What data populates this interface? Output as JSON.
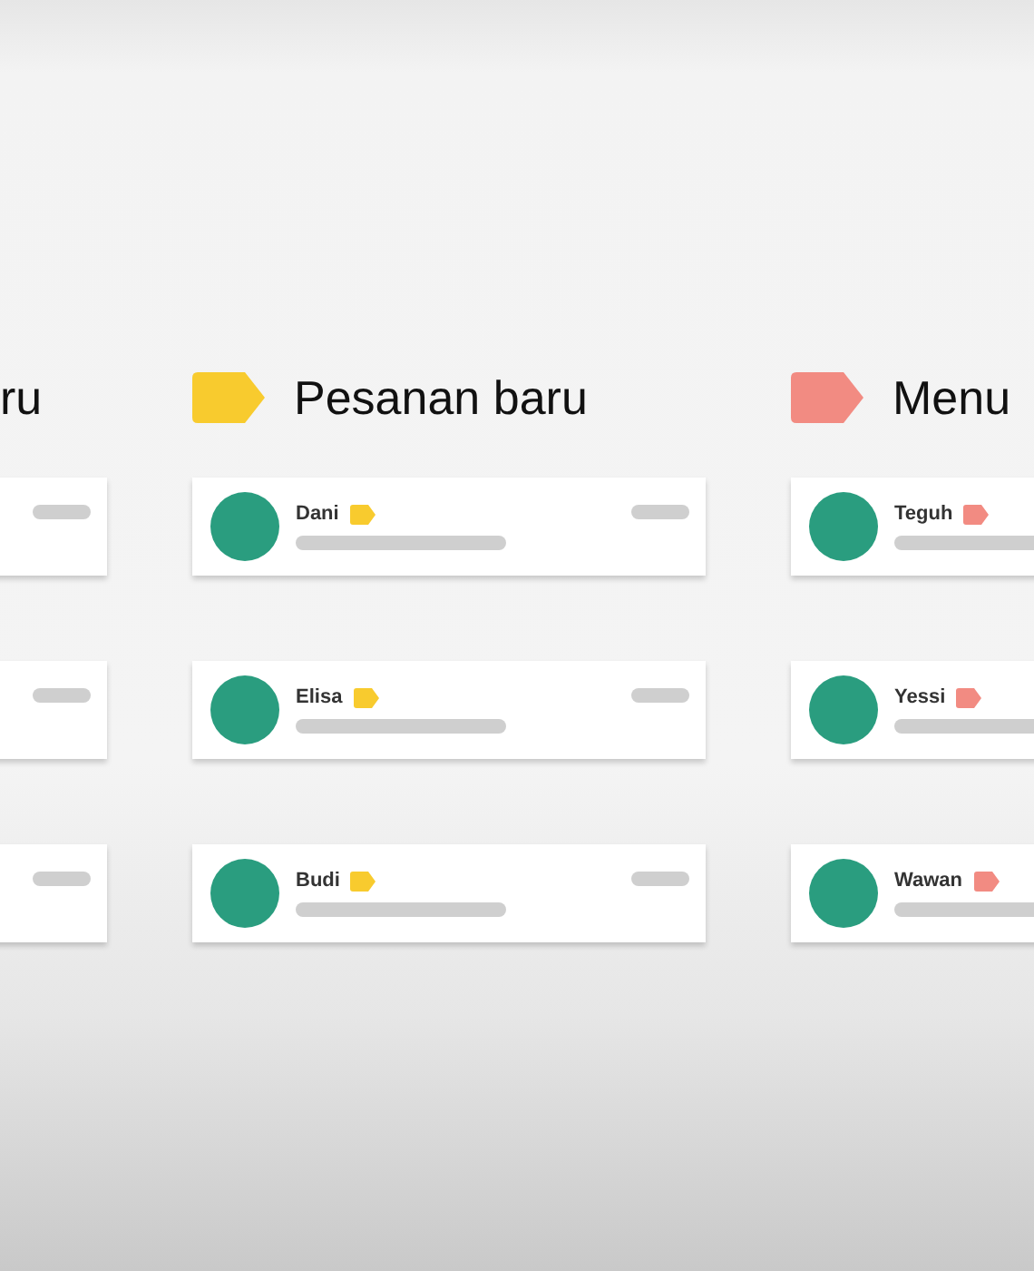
{
  "columns": [
    {
      "heading": "ru",
      "cards": [
        {
          "kind": "cut-left"
        },
        {
          "kind": "cut-left"
        },
        {
          "kind": "cut-left"
        }
      ]
    },
    {
      "heading": "Pesanan baru",
      "color": "#f8cb2e",
      "cards": [
        {
          "kind": "full",
          "name": "Dani"
        },
        {
          "kind": "full",
          "name": "Elisa"
        },
        {
          "kind": "full",
          "name": "Budi"
        }
      ]
    },
    {
      "heading": "Menu",
      "color": "#f28b82",
      "cards": [
        {
          "kind": "cut-right",
          "name": "Teguh"
        },
        {
          "kind": "cut-right",
          "name": "Yessi"
        },
        {
          "kind": "cut-right",
          "name": "Wawan"
        }
      ]
    }
  ]
}
